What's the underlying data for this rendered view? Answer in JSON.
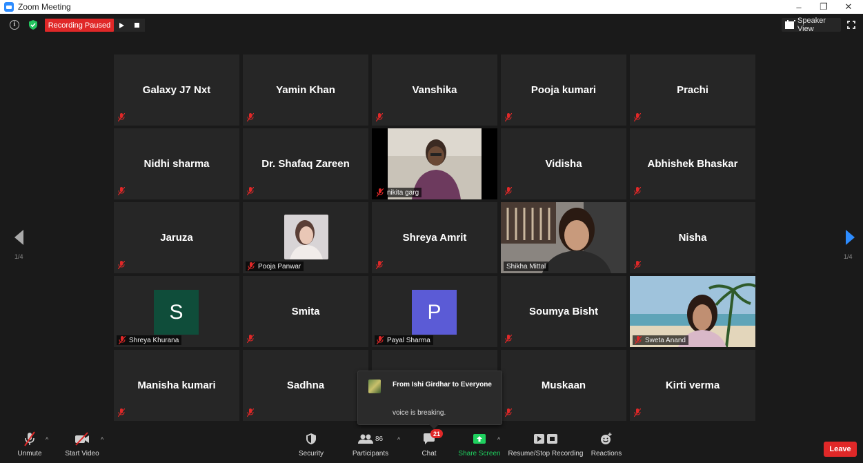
{
  "window": {
    "title": "Zoom Meeting"
  },
  "topbar": {
    "recording_status": "Recording Paused",
    "view_button": "Speaker View",
    "info_glyph": "i"
  },
  "pager": {
    "left": "1/4",
    "right": "1/4"
  },
  "participants": [
    {
      "name": "Galaxy J7 Nxt",
      "video": false
    },
    {
      "name": "Yamin Khan",
      "video": false
    },
    {
      "name": "Vanshika",
      "video": false
    },
    {
      "name": "Pooja kumari",
      "video": false
    },
    {
      "name": "Prachi",
      "video": false
    },
    {
      "name": "Nidhi sharma",
      "video": false
    },
    {
      "name": "Dr. Shafaq Zareen",
      "video": false
    },
    {
      "name": "nikita garg",
      "video": true
    },
    {
      "name": "Vidisha",
      "video": false
    },
    {
      "name": "Abhishek Bhaskar",
      "video": false
    },
    {
      "name": "Jaruza",
      "video": false
    },
    {
      "name": "Pooja Panwar",
      "photo": true
    },
    {
      "name": "Shreya Amrit",
      "video": false
    },
    {
      "name": "Shikha Mittal",
      "video": true,
      "active_speaker": true
    },
    {
      "name": "Nisha",
      "video": false
    },
    {
      "name": "Shreya Khurana",
      "avatar_letter": "S",
      "avatar_color": "#0f4d3a"
    },
    {
      "name": "Smita",
      "video": false
    },
    {
      "name": "Payal Sharma",
      "avatar_letter": "P",
      "avatar_color": "#5b5bd6"
    },
    {
      "name": "Soumya Bisht",
      "video": false
    },
    {
      "name": "Sweta Anand",
      "video": true
    },
    {
      "name": "Manisha kumari",
      "video": false
    },
    {
      "name": "Sadhna",
      "video": false
    },
    {
      "name": "",
      "video": false
    },
    {
      "name": "Muskaan",
      "video": false
    },
    {
      "name": "Kirti verma",
      "video": false
    }
  ],
  "chat_toast": {
    "from": "From Ishi Girdhar to Everyone",
    "message": "voice is breaking."
  },
  "toolbar": {
    "unmute": "Unmute",
    "start_video": "Start Video",
    "security": "Security",
    "participants": "Participants",
    "participant_count": "86",
    "chat": "Chat",
    "chat_badge": "21",
    "share_screen": "Share Screen",
    "recording": "Resume/Stop Recording",
    "reactions": "Reactions",
    "leave": "Leave"
  },
  "colors": {
    "accent_blue": "#2d8cff",
    "record_red": "#e02828",
    "share_green": "#1fd15f",
    "active_speaker": "#a4d65e"
  }
}
